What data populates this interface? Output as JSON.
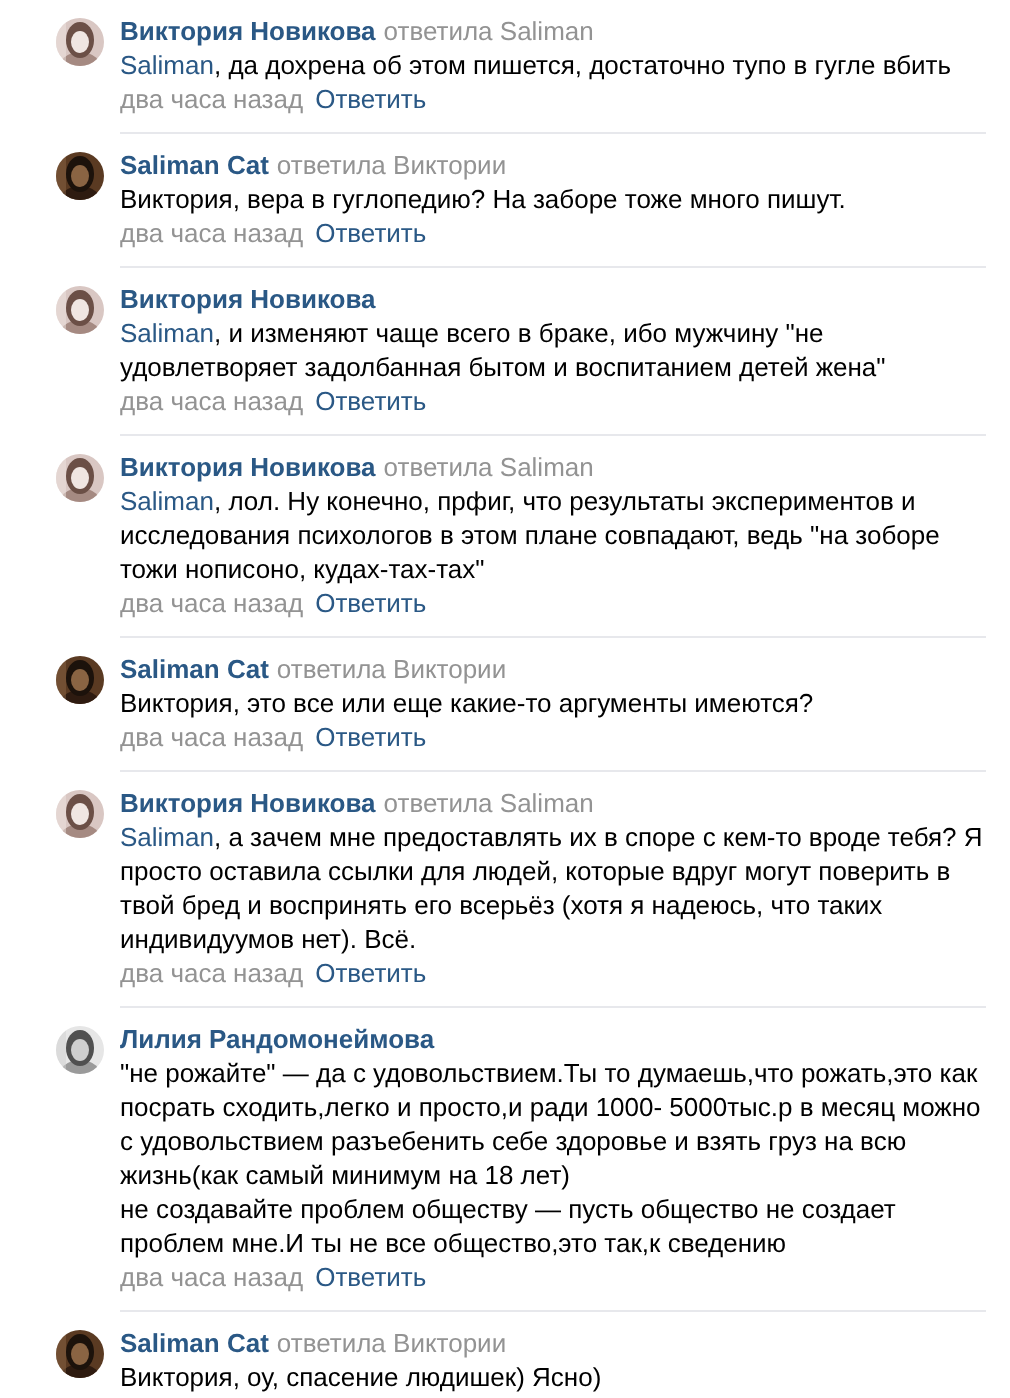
{
  "comments": [
    {
      "author": "Виктория Новикова",
      "reply_note": "ответила Saliman",
      "mention": "Saliman",
      "text": ", да дохрена об этом пишется, достаточно тупо в гугле вбить",
      "time": "два часа назад",
      "reply_label": "Ответить"
    },
    {
      "author": "Saliman Cat",
      "reply_note": "ответила Виктории",
      "text": "Виктория, вера в гуглопедию? На заборе тоже много пишут.",
      "time": "два часа назад",
      "reply_label": "Ответить"
    },
    {
      "author": "Виктория Новикова",
      "mention": "Saliman",
      "text": ", и изменяют чаще всего в браке, ибо мужчину \"не удовлетворяет задолбанная бытом и воспитанием детей жена\"",
      "time": "два часа назад",
      "reply_label": "Ответить"
    },
    {
      "author": "Виктория Новикова",
      "reply_note": "ответила Saliman",
      "mention": "Saliman",
      "text": ", лол. Ну конечно, прфиг, что результаты экспериментов и исследования психологов в этом плане совпадают, ведь \"на зоборе тожи нописоно, кудах-тах-тах\"",
      "time": "два часа назад",
      "reply_label": "Ответить"
    },
    {
      "author": "Saliman Cat",
      "reply_note": "ответила Виктории",
      "text": "Виктория, это все или еще какие-то аргументы имеются?",
      "time": "два часа назад",
      "reply_label": "Ответить"
    },
    {
      "author": "Виктория Новикова",
      "reply_note": "ответила Saliman",
      "mention": "Saliman",
      "text": ", а зачем мне предоставлять их в споре с кем-то вроде тебя? Я просто оставила ссылки для людей, которые вдруг могут поверить в твой бред и воспринять его всерьёз (хотя я надеюсь, что таких индивидуумов нет). Всё.",
      "time": "два часа назад",
      "reply_label": "Ответить"
    },
    {
      "author": "Лилия Рандомонеймова",
      "text": "\"не рожайте\" — да с удовольствием.Ты то думаешь,что рожать,это как посрать сходить,легко и просто,и ради 1000- 5000тыс.р в месяц можно с удовольствием разъебенить себе здоровье и взять груз на всю жизнь(как самый минимум на 18 лет)\nне создавайте проблем обществу — пусть общество не создает проблем мне.И ты не все общество,это так,к сведению",
      "time": "два часа назад",
      "reply_label": "Ответить"
    },
    {
      "author": "Saliman Cat",
      "reply_note": "ответила Виктории",
      "text": "Виктория, оу, спасение людишек) Ясно)"
    }
  ]
}
